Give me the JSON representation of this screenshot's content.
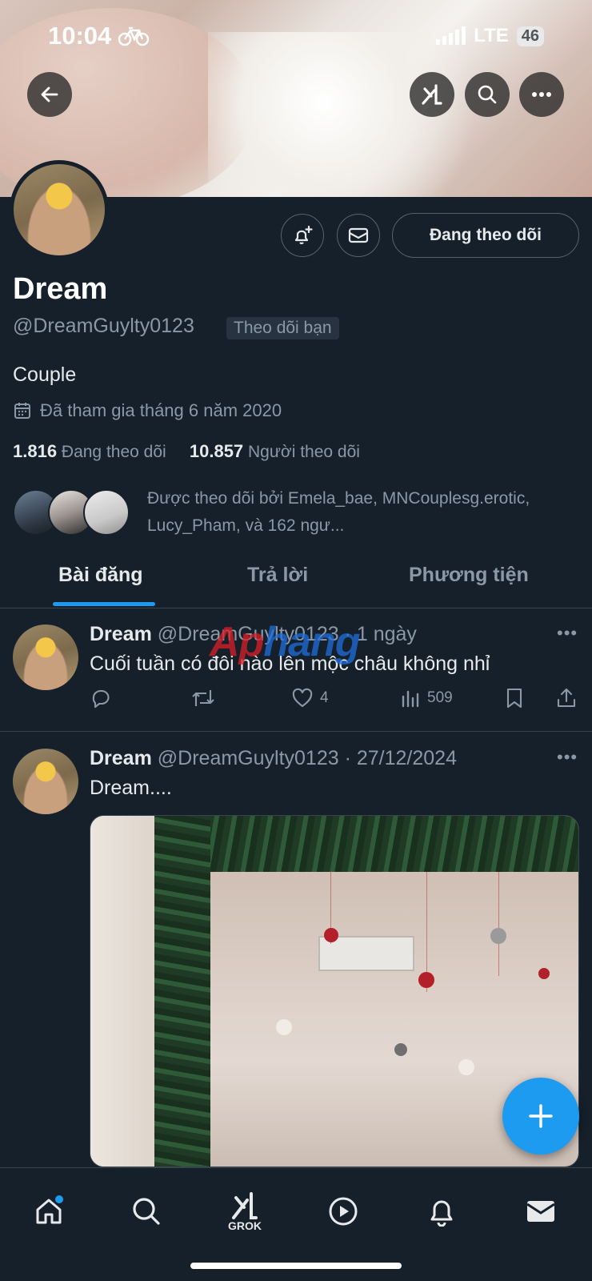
{
  "status_bar": {
    "time": "10:04",
    "network": "LTE",
    "battery": "46"
  },
  "profile": {
    "name": "Dream",
    "handle": "@DreamGuylty0123",
    "follows_you_badge": "Theo dõi bạn",
    "bio": "Couple",
    "joined": "Đã tham gia tháng 6 năm 2020",
    "following_count": "1.816",
    "following_label": "Đang theo dõi",
    "followers_count": "10.857",
    "followers_label": "Người theo dõi",
    "followed_by_text": "Được theo dõi bởi Emela_bae, MNCouplesg.erotic, Lucy_Pham, và 162 ngư...",
    "following_button": "Đang theo dõi"
  },
  "tabs": [
    {
      "label": "Bài đăng",
      "active": true
    },
    {
      "label": "Trả lời",
      "active": false
    },
    {
      "label": "Phương tiện",
      "active": false
    }
  ],
  "posts": [
    {
      "name": "Dream",
      "meta": "@DreamGuylty0123 · 1 ngày",
      "text": "Cuối tuần có đôi nào lên mộc châu không nhỉ",
      "likes": "4",
      "views": "509"
    },
    {
      "name": "Dream",
      "meta": "@DreamGuylty0123 · 27/12/2024",
      "text": "Dream...."
    }
  ],
  "watermark": {
    "part1": "Ap",
    "part2": "hang"
  },
  "bottom_nav": {
    "grok_label": "GROK"
  },
  "colors": {
    "background": "#15202b",
    "accent": "#1d9bf0",
    "muted": "#8b98a5"
  },
  "icons": [
    "back-arrow-icon",
    "grok-icon",
    "search-icon",
    "more-icon",
    "bell-plus-icon",
    "mail-icon",
    "calendar-icon",
    "reply-icon",
    "retweet-icon",
    "heart-icon",
    "views-icon",
    "bookmark-icon",
    "share-icon",
    "plus-icon",
    "home-icon",
    "play-icon",
    "bell-icon"
  ]
}
